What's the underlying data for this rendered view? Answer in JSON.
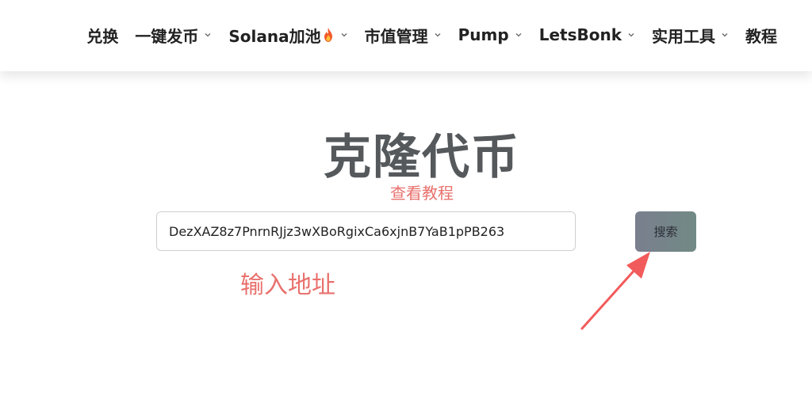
{
  "nav": {
    "items": [
      {
        "label": "兑换",
        "has_dropdown": false
      },
      {
        "label": "一键发币",
        "has_dropdown": true
      },
      {
        "label": "Solana加池",
        "has_dropdown": true,
        "icon": "fire-icon"
      },
      {
        "label": "市值管理",
        "has_dropdown": true
      },
      {
        "label": "Pump",
        "has_dropdown": true
      },
      {
        "label": "LetsBonk",
        "has_dropdown": true
      },
      {
        "label": "实用工具",
        "has_dropdown": true
      },
      {
        "label": "教程",
        "has_dropdown": false
      }
    ]
  },
  "main": {
    "title": "克隆代币",
    "tutorial_link": "查看教程",
    "address_input": {
      "value": "DezXAZ8z7PnrnRJjz3wXBoRgixCa6xjnB7YaB1pPB263",
      "placeholder": ""
    },
    "search_button": "搜索"
  },
  "annotations": {
    "hint_label": "输入地址",
    "arrow": "red-arrow-pointing-to-search-button"
  },
  "colors": {
    "accent_red": "#e8716d",
    "title_gray": "#55595c",
    "arrow_red": "#f25b5b",
    "button_gradient_start": "#7a7f8e",
    "button_gradient_end": "#728a85"
  }
}
